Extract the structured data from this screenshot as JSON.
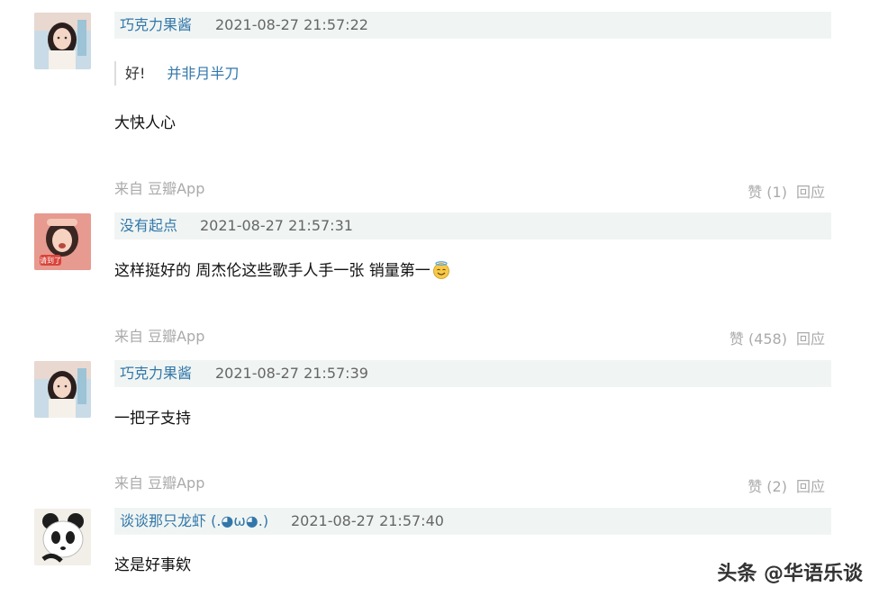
{
  "comments": [
    {
      "author": "巧克力果酱",
      "time": "2021-08-27 21:57:22",
      "quote_text": "好!",
      "quote_author": "并非月半刀",
      "content": "大快人心",
      "source": "来自 豆瓣App",
      "like_label": "赞 (1)",
      "reply_label": "回应",
      "avatar_icon": "girl-portrait-avatar"
    },
    {
      "author": "没有起点",
      "time": "2021-08-27 21:57:31",
      "content": "这样挺好的 周杰伦这些歌手人手一张 销量第一",
      "emoji": "smiling-halo-face-emoji",
      "source": "来自 豆瓣App",
      "like_label": "赞 (458)",
      "reply_label": "回应",
      "avatar_icon": "surprised-girl-avatar",
      "avatar_caption": "请到了"
    },
    {
      "author": "巧克力果酱",
      "time": "2021-08-27 21:57:39",
      "content": "一把子支持",
      "source": "来自 豆瓣App",
      "like_label": "赞 (2)",
      "reply_label": "回应",
      "avatar_icon": "girl-portrait-avatar"
    },
    {
      "author": "谈谈那只龙虾 (.◕ω◕.)",
      "time": "2021-08-27 21:57:40",
      "content": "这是好事欸",
      "avatar_icon": "panda-avatar"
    }
  ],
  "watermark": "头条 @华语乐谈",
  "colors": {
    "author_link": "#3377aa",
    "meta_background": "#f0f5f3",
    "muted_text": "#aaaaaa"
  }
}
